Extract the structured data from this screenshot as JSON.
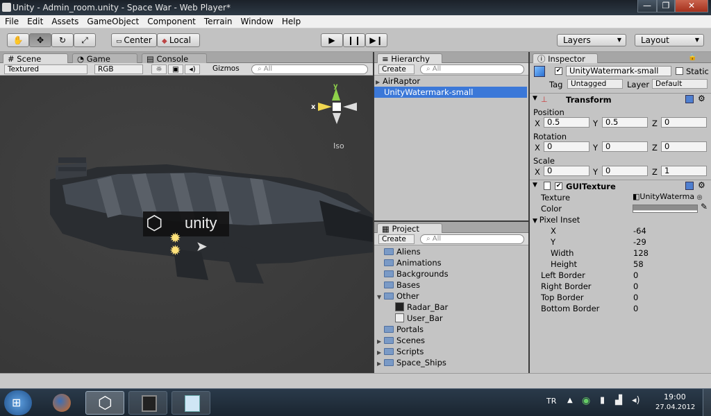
{
  "window": {
    "title": "Unity - Admin_room.unity - Space War - Web Player*",
    "minimize": "—",
    "maximize": "❐",
    "close": "✕"
  },
  "menu": [
    "File",
    "Edit",
    "Assets",
    "GameObject",
    "Component",
    "Terrain",
    "Window",
    "Help"
  ],
  "toolbar": {
    "pivot": "Center",
    "space": "Local",
    "layers": "Layers",
    "layout": "Layout"
  },
  "scene": {
    "tabs": [
      "Scene",
      "Game",
      "Console"
    ],
    "render_mode": "Textured",
    "color_mode": "RGB",
    "gizmos": "Gizmos",
    "search_placeholder": "All",
    "gizmo_x": "x",
    "gizmo_y": "y",
    "projection": "Iso",
    "watermark_text": "unity"
  },
  "hierarchy": {
    "title": "Hierarchy",
    "create": "Create",
    "search_placeholder": "All",
    "items": [
      "AirRaptor",
      "UnityWatermark-small"
    ]
  },
  "project": {
    "title": "Project",
    "create": "Create",
    "search_placeholder": "All",
    "items": [
      "Aliens",
      "Animations",
      "Backgrounds",
      "Bases",
      "Other",
      "Radar_Bar",
      "User_Bar",
      "Portals",
      "Scenes",
      "Scripts",
      "Space_Ships"
    ]
  },
  "inspector": {
    "title": "Inspector",
    "object_name": "UnityWatermark-small",
    "static_label": "Static",
    "tag_label": "Tag",
    "tag_value": "Untagged",
    "layer_label": "Layer",
    "layer_value": "Default",
    "transform": {
      "title": "Transform",
      "position_label": "Position",
      "rotation_label": "Rotation",
      "scale_label": "Scale",
      "x": "X",
      "y": "Y",
      "z": "Z",
      "position": [
        "0.5",
        "0.5",
        "0"
      ],
      "rotation": [
        "0",
        "0",
        "0"
      ],
      "scale": [
        "0",
        "0",
        "1"
      ]
    },
    "guitexture": {
      "title": "GUITexture",
      "texture_label": "Texture",
      "texture_value": "UnityWaterma",
      "color_label": "Color",
      "pixel_inset_label": "Pixel Inset",
      "inset_x_label": "X",
      "inset_x": "-64",
      "inset_y_label": "Y",
      "inset_y": "-29",
      "width_label": "Width",
      "width": "128",
      "height_label": "Height",
      "height": "58",
      "left_border_label": "Left Border",
      "left_border": "0",
      "right_border_label": "Right Border",
      "right_border": "0",
      "top_border_label": "Top Border",
      "top_border": "0",
      "bottom_border_label": "Bottom Border",
      "bottom_border": "0"
    }
  },
  "taskbar": {
    "lang": "TR",
    "time": "19:00",
    "date": "27.04.2012"
  }
}
